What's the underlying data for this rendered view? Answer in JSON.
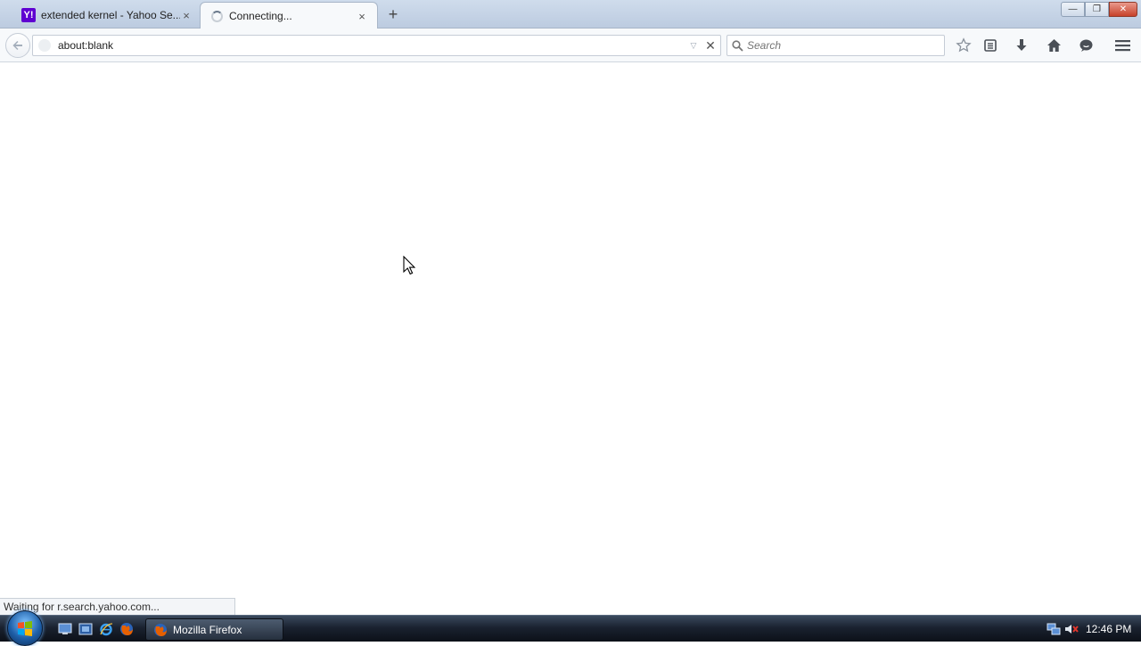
{
  "tabs": [
    {
      "title": "extended kernel - Yahoo Se...",
      "favicon": "yahoo-icon",
      "active": false
    },
    {
      "title": "Connecting...",
      "favicon": "loading-spinner-icon",
      "active": true
    }
  ],
  "tab_close_glyph": "×",
  "new_tab_glyph": "+",
  "window_controls": {
    "minimize": "—",
    "maximize": "❐",
    "close": "✕"
  },
  "navbar": {
    "url": "about:blank",
    "search_placeholder": "Search",
    "stop_glyph": "✕",
    "dropmarker_glyph": "▽"
  },
  "statusbar": {
    "text": "Waiting for r.search.yahoo.com..."
  },
  "taskbar": {
    "task_button": "Mozilla Firefox",
    "clock": "12:46 PM"
  },
  "colors": {
    "yahoo_purple": "#5f01d1",
    "firefox_orange": "#e66000"
  }
}
